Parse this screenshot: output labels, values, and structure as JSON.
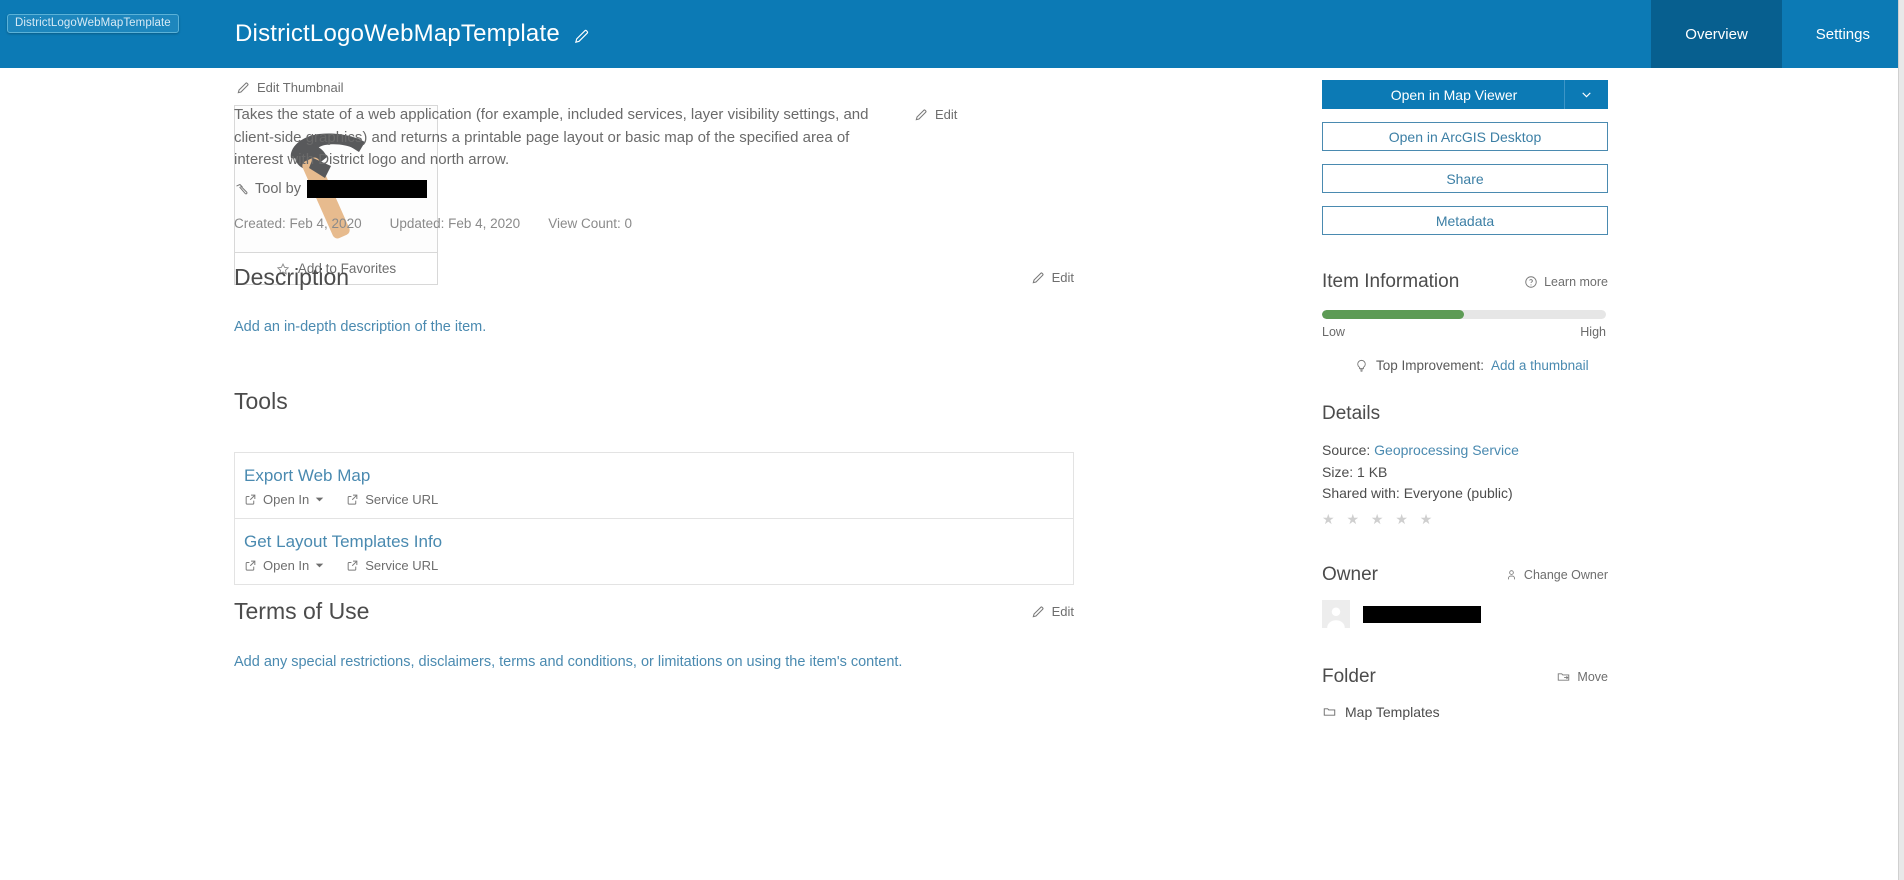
{
  "header": {
    "tooltip": "DistrictLogoWebMapTemplate",
    "title": "DistrictLogoWebMapTemplate",
    "tabs": [
      {
        "label": "Overview",
        "active": true
      },
      {
        "label": "Settings",
        "active": false
      }
    ],
    "brand_color": "#0c7ab5",
    "active_tab_color": "#075f8f"
  },
  "thumbnail": {
    "edit_label": "Edit Thumbnail",
    "favorite_label": "Add to Favorites",
    "icon": "hammer-tool-thumbnail"
  },
  "summary": {
    "text": "Takes the state of a web application (for example, included services, layer visibility settings, and client-side graphics) and returns a printable page layout or basic map of the specified area of interest with District logo and north arrow.",
    "edit_label": "Edit",
    "tool_by_label": "Tool by",
    "tool_by_value_redacted": true,
    "created": "Created: Feb 4, 2020",
    "updated": "Updated: Feb 4, 2020",
    "view_count": "View Count: 0"
  },
  "description": {
    "title": "Description",
    "edit_label": "Edit",
    "placeholder": "Add an in-depth description of the item."
  },
  "tools": {
    "title": "Tools",
    "items": [
      {
        "name": "Export Web Map",
        "open_in_label": "Open In",
        "service_url_label": "Service URL"
      },
      {
        "name": "Get Layout Templates Info",
        "open_in_label": "Open In",
        "service_url_label": "Service URL"
      }
    ]
  },
  "terms": {
    "title": "Terms of Use",
    "edit_label": "Edit",
    "placeholder": "Add any special restrictions, disclaimers, terms and conditions, or limitations on using the item's content."
  },
  "sidebar": {
    "buttons": {
      "open_map_viewer": "Open in Map Viewer",
      "open_arcgis_desktop": "Open in ArcGIS Desktop",
      "share": "Share",
      "metadata": "Metadata"
    },
    "item_information": {
      "title": "Item Information",
      "learn_more": "Learn more",
      "progress_percent": 50,
      "progress_color": "#5d9b55",
      "low_label": "Low",
      "high_label": "High",
      "top_improvement_label": "Top Improvement:",
      "top_improvement_link": "Add a thumbnail"
    },
    "details": {
      "title": "Details",
      "source_label": "Source:",
      "source_value": "Geoprocessing Service",
      "size_label": "Size:",
      "size_value": "1 KB",
      "shared_label": "Shared with:",
      "shared_value": "Everyone (public)",
      "stars": "★ ★ ★ ★ ★",
      "rating": 0
    },
    "owner": {
      "title": "Owner",
      "change_owner_label": "Change Owner",
      "name_redacted": true
    },
    "folder": {
      "title": "Folder",
      "move_label": "Move",
      "folder_name": "Map Templates"
    }
  }
}
